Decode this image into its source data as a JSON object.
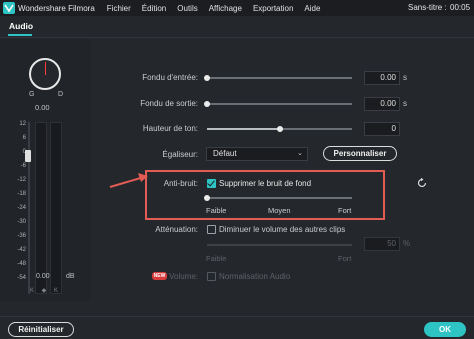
{
  "app": {
    "name": "Wondershare Filmora",
    "doc_title": "Sans-titre :",
    "doc_time": "00:05"
  },
  "menu": [
    "Fichier",
    "Édition",
    "Outils",
    "Affichage",
    "Exportation",
    "Aide"
  ],
  "tabs": [
    {
      "label": "Audio",
      "active": true
    }
  ],
  "mixer": {
    "left_label": "G",
    "right_label": "D",
    "balance_value": "0.00",
    "scale_labels": [
      "12",
      "6",
      "0",
      "-6",
      "-12",
      "-18",
      "-24",
      "-30",
      "-36",
      "-42",
      "-48",
      "-54"
    ],
    "level_value": "0.00",
    "level_unit": "dB",
    "controls": "K ◆ K"
  },
  "fade_in": {
    "label": "Fondu d'entrée:",
    "value": "0.00",
    "unit": "s",
    "level": 0.0
  },
  "fade_out": {
    "label": "Fondu de sortie:",
    "value": "0.00",
    "unit": "s",
    "level": 0.0
  },
  "pitch": {
    "label": "Hauteur de ton:",
    "value": "0",
    "level": 0.5
  },
  "equalizer": {
    "label": "Égaliseur:",
    "selected": "Défaut",
    "customize_label": "Personnaliser"
  },
  "denoise": {
    "label": "Anti-bruit:",
    "checkbox_label": "Supprimer le bruit de fond",
    "checked": true,
    "level": 0.0,
    "ticks": [
      "Faible",
      "Moyen",
      "Fort"
    ]
  },
  "attenuation": {
    "label": "Atténuation:",
    "checkbox_label": "Diminuer le volume des autres clips",
    "checked": false,
    "value": "50",
    "unit": "%",
    "ticks": [
      "Faible",
      "Fort"
    ]
  },
  "volume": {
    "badge": "NEW",
    "label": "Volume:",
    "checkbox_label": "Normalisation Audio",
    "checked": false
  },
  "footer": {
    "reset_label": "Réinitialiser",
    "ok_label": "OK"
  },
  "colors": {
    "accent": "#2ec4c4",
    "highlight_box": "#e25c54",
    "background": "#24272b"
  }
}
